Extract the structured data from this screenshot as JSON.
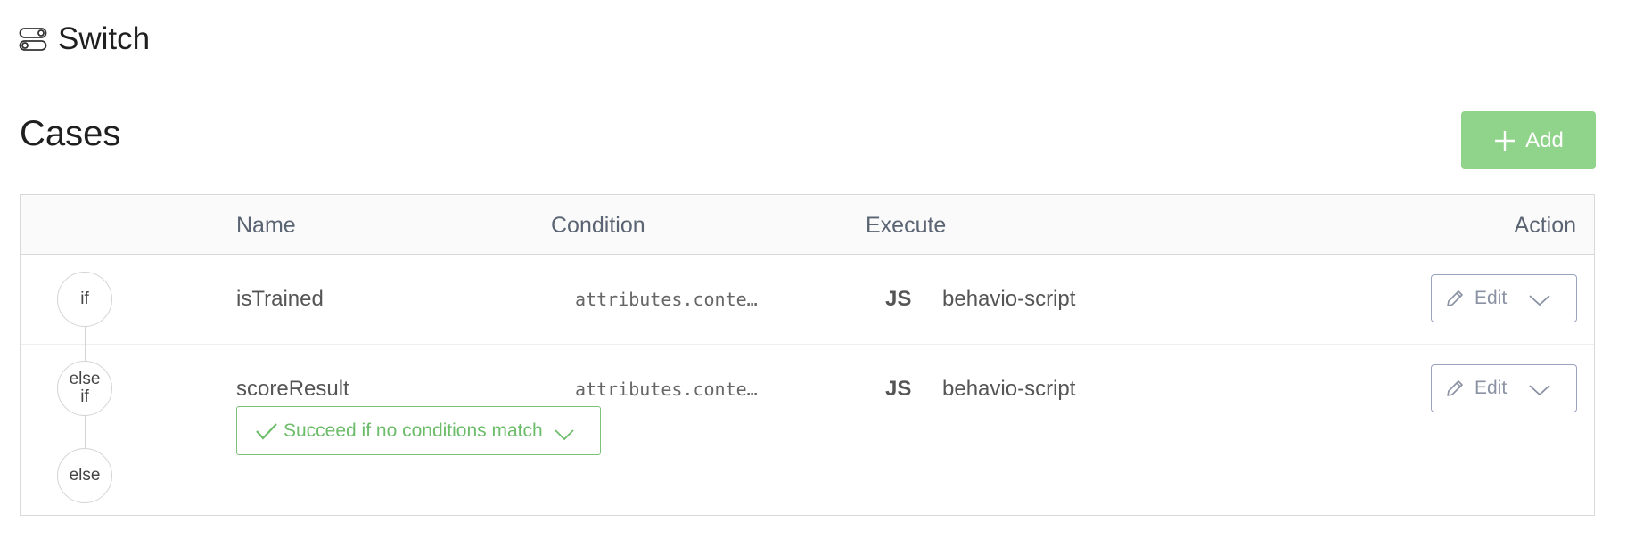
{
  "header": {
    "icon": "toggle-switch-icon",
    "title": "Switch"
  },
  "cases": {
    "title": "Cases",
    "add_label": "Add",
    "columns": {
      "name": "Name",
      "condition": "Condition",
      "execute": "Execute",
      "action": "Action"
    },
    "rows": [
      {
        "type": "if",
        "name": "isTrained",
        "condition": "attributes.conte…",
        "exec_lang": "JS",
        "exec_target": "behavio-script",
        "edit_label": "Edit"
      },
      {
        "type_line1": "else",
        "type_line2": "if",
        "name": "scoreResult",
        "condition": "attributes.conte…",
        "exec_lang": "JS",
        "exec_target": "behavio-script",
        "edit_label": "Edit"
      }
    ],
    "else_row": {
      "type": "else",
      "default_action": "Succeed if no conditions match"
    }
  },
  "colors": {
    "accent_green": "#90d38a",
    "success_text": "#6cbc6a",
    "edit_border": "#9aa3c0"
  }
}
